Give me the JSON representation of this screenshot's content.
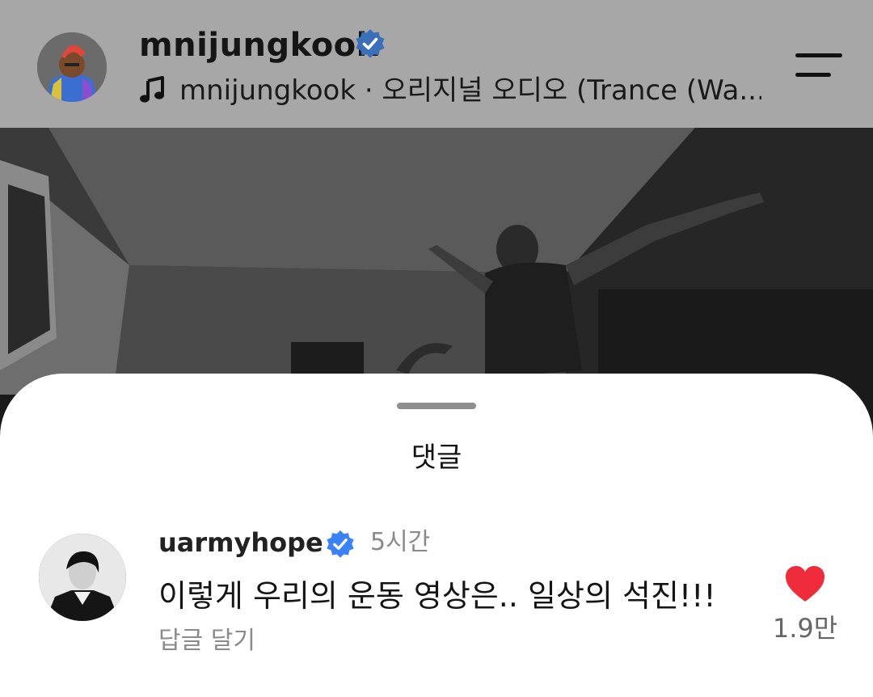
{
  "header": {
    "username": "mnijungkook",
    "audio": "mnijungkook · 오리지널 오디오 (Trance (Wa..."
  },
  "icons": {
    "verified": "verified-badge-icon",
    "music": "music-note-icon",
    "menu": "hamburger-menu-icon",
    "like": "heart-icon"
  },
  "comments_sheet": {
    "title": "댓글",
    "comments": [
      {
        "username": "uarmyhope",
        "time": "5시간",
        "text": "이렇게 우리의 운동 영상은.. 일상의 석진!!!",
        "reply_label": "답글 달기",
        "likes": "1.9만"
      }
    ]
  },
  "colors": {
    "verified_blue": "#3b82f6",
    "heart_red": "#ef2b3c",
    "header_bg": "#a7a7a7",
    "sheet_bg": "#ffffff"
  }
}
